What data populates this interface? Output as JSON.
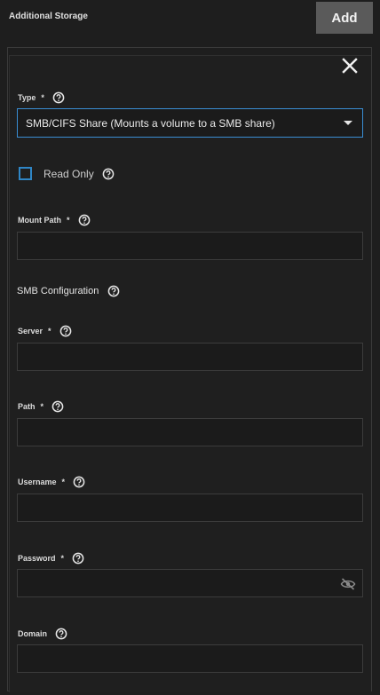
{
  "header": {
    "title": "Additional Storage",
    "add_label": "Add"
  },
  "form": {
    "type": {
      "label": "Type",
      "required": "*",
      "value": "SMB/CIFS Share (Mounts a volume to a SMB share)"
    },
    "read_only": {
      "label": "Read Only",
      "checked": false
    },
    "mount_path": {
      "label": "Mount Path",
      "required": "*",
      "value": ""
    },
    "smb_section": {
      "title": "SMB Configuration"
    },
    "server": {
      "label": "Server",
      "required": "*",
      "value": ""
    },
    "path": {
      "label": "Path",
      "required": "*",
      "value": ""
    },
    "username": {
      "label": "Username",
      "required": "*",
      "value": ""
    },
    "password": {
      "label": "Password",
      "required": "*",
      "value": ""
    },
    "domain": {
      "label": "Domain",
      "value": ""
    }
  },
  "colors": {
    "accent": "#3a8ed4",
    "background": "#1e1e1e",
    "button": "#5a5a5a"
  },
  "icons": [
    "close-icon",
    "help-icon",
    "caret-down-icon",
    "eye-off-icon"
  ]
}
